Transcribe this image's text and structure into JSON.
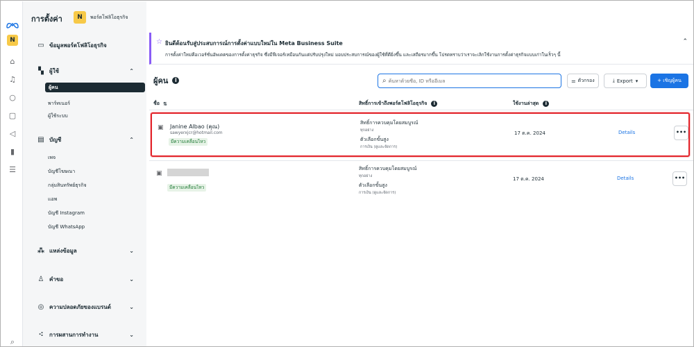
{
  "rail": {
    "account_initial": "N",
    "icons": [
      "home-icon",
      "bell-icon",
      "chat-icon",
      "pages-icon",
      "megaphone-icon",
      "chart-icon",
      "menu-icon",
      "search-icon"
    ]
  },
  "sidebar": {
    "title": "การตั้งค่า",
    "account_initial": "N",
    "account_name": "พอร์ตโฟลิโอธุรกิจ",
    "portfolio_info": "ข้อมูลพอร์ตโฟลิโอธุรกิจ",
    "users_section": "ผู้ใช้",
    "users_items": [
      "ผู้คน",
      "พาร์ทเนอร์",
      "ผู้ใช้ระบบ"
    ],
    "accounts_section": "บัญชี",
    "accounts_items": [
      "เพจ",
      "บัญชีโฆษณา",
      "กลุ่มสินทรัพย์ธุรกิจ",
      "แอพ",
      "บัญชี Instagram",
      "บัญชี WhatsApp"
    ],
    "data_sources": "แหล่งข้อมูล",
    "requests": "คำขอ",
    "brand_safety": "ความปลอดภัยของแบรนด์",
    "integrations": "การผสานการทำงาน"
  },
  "banner": {
    "title": "ยินดีต้อนรับสู่ประสบการณ์การตั้งค่าแบบใหม่ใน Meta Business Suite",
    "body": "การตั้งค่าใหม่คือเวอร์ชั่นอัพเดตของการตั้งค่าธุรกิจ ซึ่งมีฟีเจอร์เหมือนกันแต่ปรับปรุงใหม่ มอบประสบการณ์ของผู้ใช้ที่ดียิ่งขึ้น และเสถียรมากขึ้น โปรดทราบว่าเราจะเลิกใช้งานการตั้งค่าธุรกิจแบบเก่าในเร็วๆ นี้"
  },
  "page": {
    "heading": "ผู้คน",
    "search_placeholder": "ค้นหาด้วยชื่อ, ID หรืออีเมล",
    "filter_label": "ตัวกรอง",
    "export_label": "Export",
    "invite_label": "+ เชิญผู้คน"
  },
  "table": {
    "col_name": "ชื่อ",
    "col_access": "สิทธิ์การเข้าถึงพอร์ตโฟลิโอธุรกิจ",
    "col_last_used": "ใช้งานล่าสุด",
    "rows": [
      {
        "name": "Janine Albao (คุณ)",
        "email": "sawyerxjcr@hotmail.com",
        "badge": "มีความเคลื่อนไหว",
        "perm1": "สิทธิ์การควบคุมโดยสมบูรณ์",
        "perm1_sub": "ทุกอย่าง",
        "perm2": "ตัวเลือกขั้นสูง",
        "perm2_sub": "การเงิน (ดูและจัดการ)",
        "date": "17 ต.ค. 2024",
        "details": "Details",
        "more": "•••"
      },
      {
        "name": "",
        "email": "",
        "badge": "มีความเคลื่อนไหว",
        "perm1": "สิทธิ์การควบคุมโดยสมบูรณ์",
        "perm1_sub": "ทุกอย่าง",
        "perm2": "ตัวเลือกขั้นสูง",
        "perm2_sub": "การเงิน (ดูและจัดการ)",
        "date": "17 ต.ค. 2024",
        "details": "Details",
        "more": "•••"
      }
    ]
  }
}
